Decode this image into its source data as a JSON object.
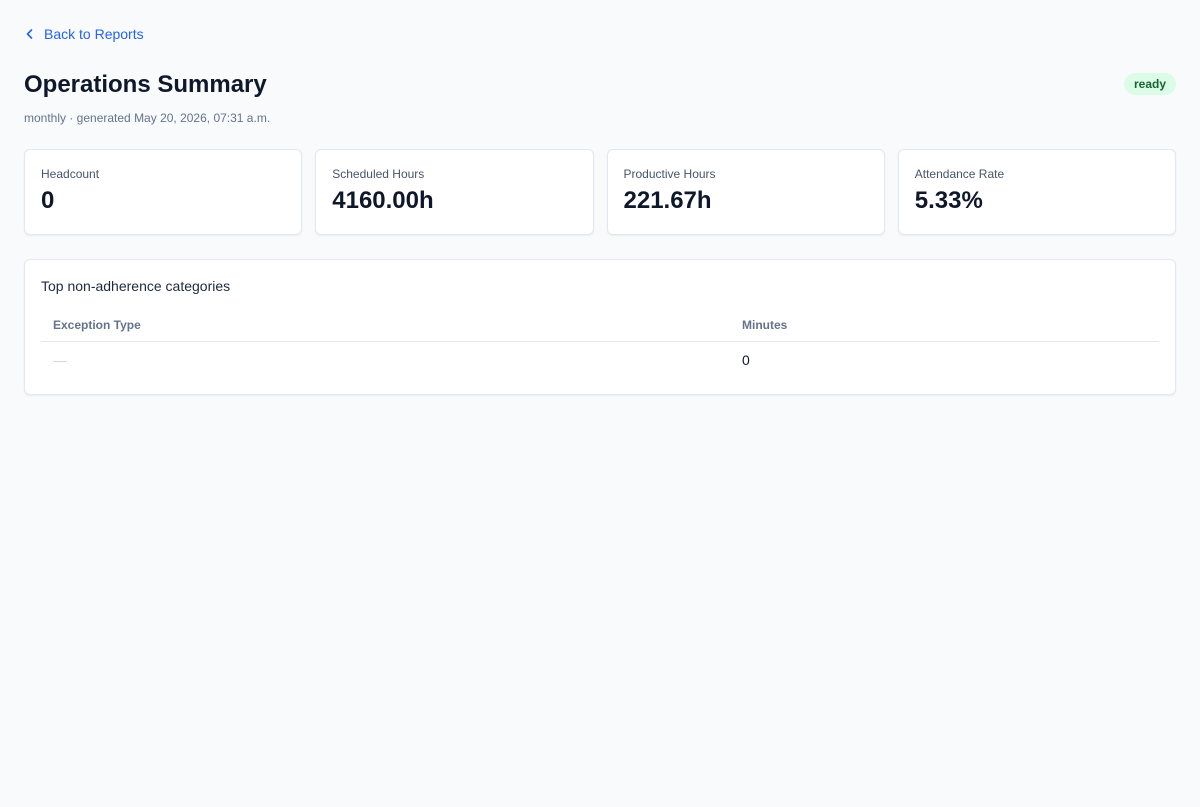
{
  "nav": {
    "back_label": "Back to Reports"
  },
  "header": {
    "title": "Operations Summary",
    "subtitle": "monthly · generated May 20, 2026, 07:31 a.m.",
    "status_badge": "ready"
  },
  "stats": [
    {
      "label": "Headcount",
      "value": "0"
    },
    {
      "label": "Scheduled Hours",
      "value": "4160.00h"
    },
    {
      "label": "Productive Hours",
      "value": "221.67h"
    },
    {
      "label": "Attendance Rate",
      "value": "5.33%"
    }
  ],
  "non_adherence": {
    "title": "Top non-adherence categories",
    "columns": [
      "Exception Type",
      "Minutes"
    ],
    "rows": [
      {
        "exception_type": "—",
        "minutes": "0"
      }
    ]
  },
  "colors": {
    "accent": "#2563eb",
    "badge_bg": "#dcfce7",
    "badge_text": "#166534"
  },
  "icons": {
    "back": "chevron-left-icon"
  }
}
